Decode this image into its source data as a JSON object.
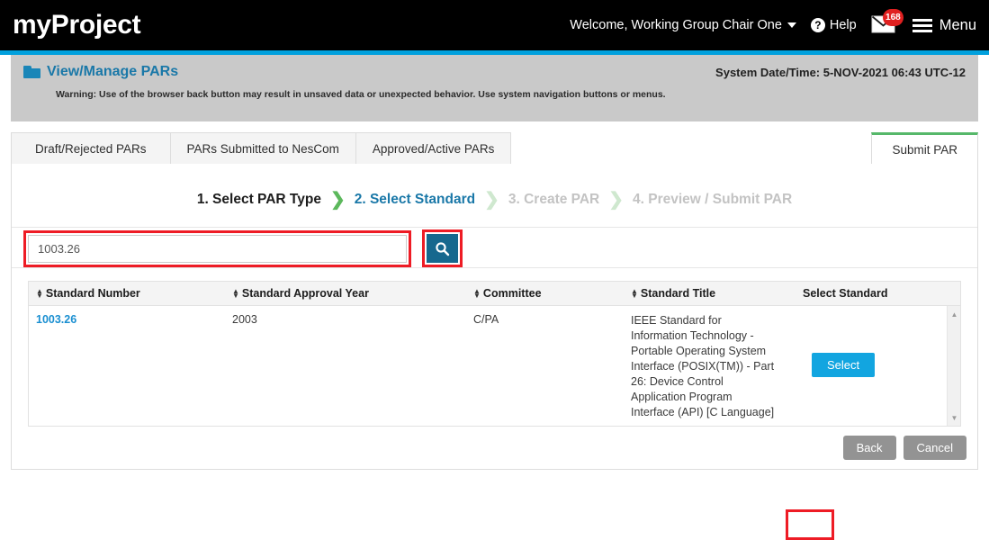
{
  "header": {
    "brand": "myProject",
    "welcome": "Welcome, Working Group Chair One",
    "help_label": "Help",
    "help_icon": "question-circle-icon",
    "mail_icon": "envelope-icon",
    "mail_badge": "168",
    "menu_label": "Menu",
    "menu_icon": "hamburger-icon",
    "accent_color": "#00a0dd"
  },
  "banner": {
    "icon": "folder-icon",
    "title": "View/Manage PARs",
    "system_datetime": "System Date/Time: 5-NOV-2021   06:43 UTC-12",
    "warning": "Warning: Use of the browser back button may result in unsaved data or unexpected behavior. Use system navigation buttons or menus."
  },
  "tabs": {
    "items": [
      {
        "label": "Draft/Rejected PARs",
        "active": false
      },
      {
        "label": "PARs Submitted to NesCom",
        "active": false
      },
      {
        "label": "Approved/Active PARs",
        "active": false
      }
    ],
    "right_tab": {
      "label": "Submit PAR",
      "active": true,
      "accent": "#56b86a"
    }
  },
  "wizard": {
    "steps": [
      {
        "label": "1. Select PAR Type",
        "state": "done"
      },
      {
        "label": "2. Select Standard",
        "state": "active"
      },
      {
        "label": "3. Create PAR",
        "state": "todo"
      },
      {
        "label": "4. Preview / Submit PAR",
        "state": "todo"
      }
    ],
    "chevron": "❯"
  },
  "search": {
    "value": "1003.26",
    "placeholder": "",
    "button_icon": "search-icon",
    "button_color": "#16688e",
    "highlight_color": "#ee1c25"
  },
  "table": {
    "columns": [
      {
        "label": "Standard Number",
        "sortable": true
      },
      {
        "label": "Standard Approval Year",
        "sortable": true
      },
      {
        "label": "Committee",
        "sortable": true
      },
      {
        "label": "Standard Title",
        "sortable": true
      },
      {
        "label": "Select Standard",
        "sortable": false
      }
    ],
    "rows": [
      {
        "standard_number": "1003.26",
        "approval_year": "2003",
        "committee": "C/PA",
        "standard_title": "IEEE Standard for Information Technology - Portable Operating System Interface (POSIX(TM)) - Part 26: Device Control Application Program Interface (API) [C Language]",
        "select_label": "Select"
      }
    ],
    "scrollbar": {
      "up_icon": "caret-up-icon",
      "down_icon": "caret-down-icon"
    }
  },
  "footer": {
    "back_label": "Back",
    "cancel_label": "Cancel"
  }
}
